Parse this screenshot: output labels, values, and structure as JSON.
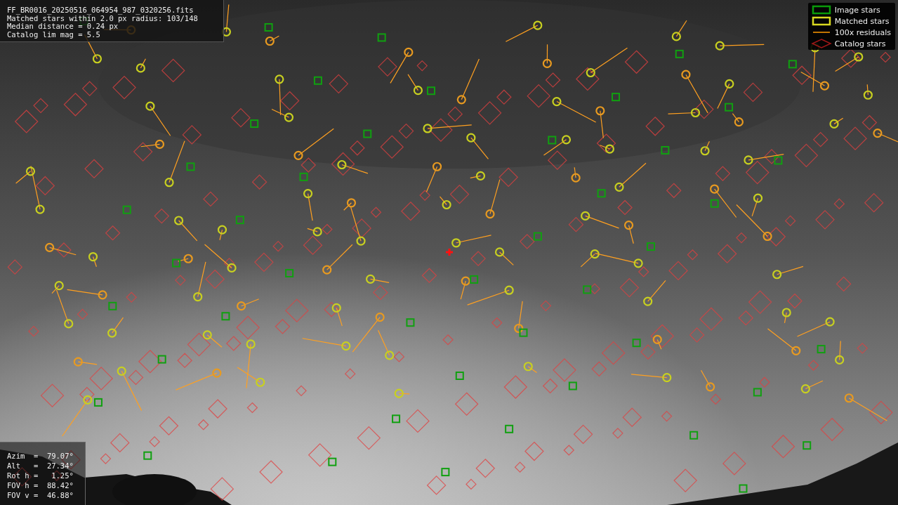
{
  "header": {
    "lines": [
      "FF_BR0016_20250516_064954_987_0320256.fits",
      "Matched stars within 2.0 px radius: 103/148",
      "Median distance = 0.24 px",
      "Catalog lim mag = 5.5"
    ]
  },
  "legend": {
    "items": [
      {
        "label": "Image stars"
      },
      {
        "kind": "matched",
        "label": "Matched stars"
      },
      {
        "kind": "residual",
        "label": "100x residuals"
      },
      {
        "kind": "catalog",
        "label": "Catalog stars"
      }
    ]
  },
  "pointing": {
    "rows": [
      "Azim  =  79.07°",
      "Alt   =  27.34°",
      "Rot h =   1.25°",
      "FOV h =  88.42°",
      "FOV v =  46.88°"
    ]
  }
}
